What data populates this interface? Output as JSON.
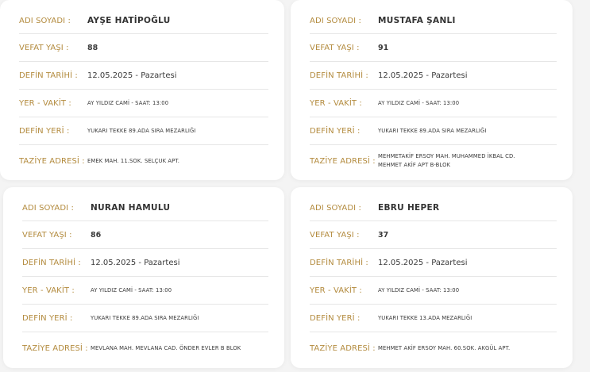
{
  "labels": {
    "name": "ADI SOYADI :",
    "age": "VEFAT YAŞI :",
    "date": "DEFİN TARİHİ :",
    "place_time": "YER - VAKİT :",
    "cemetery": "DEFİN YERİ :",
    "address": "TAZİYE ADRESİ :"
  },
  "cards": [
    {
      "name": "AYŞE HATİPOĞLU",
      "age": "88",
      "date": "12.05.2025 - Pazartesi",
      "place_time": "AY YILDIZ CAMİ - SAAT: 13:00",
      "cemetery": "YUKARI TEKKE 89.ADA SIRA MEZARLIĞI",
      "address": "EMEK MAH. 11.SOK. SELÇUK APT."
    },
    {
      "name": "MUSTAFA ŞANLI",
      "age": "91",
      "date": "12.05.2025 - Pazartesi",
      "place_time": "AY YILDIZ CAMİ - SAAT: 13:00",
      "cemetery": "YUKARI TEKKE 89.ADA SIRA MEZARLIĞI",
      "address": "MEHMETAKİF ERSOY MAH. MUHAMMED İKBAL CD. MEHMET AKİF APT B-BLOK"
    },
    {
      "name": "NURAN HAMULU",
      "age": "86",
      "date": "12.05.2025 - Pazartesi",
      "place_time": "AY YILDIZ CAMİ - SAAT: 13:00",
      "cemetery": "YUKARI TEKKE 89.ADA SIRA MEZARLIĞI",
      "address": "MEVLANA MAH. MEVLANA CAD. ÖNDER EVLER B BLOK"
    },
    {
      "name": "EBRU HEPER",
      "age": "37",
      "date": "12.05.2025 - Pazartesi",
      "place_time": "AY YILDIZ CAMİ - SAAT: 13:00",
      "cemetery": "YUKARI TEKKE 13.ADA MEZARLIĞI",
      "address": "MEHMET AKİF ERSOY MAH. 60.SOK. AKGÜL APT."
    }
  ],
  "colors": {
    "label": "#b38b3e",
    "value": "#3a3a3a",
    "card_bg": "#ffffff",
    "page_bg": "#f4f4f4"
  }
}
